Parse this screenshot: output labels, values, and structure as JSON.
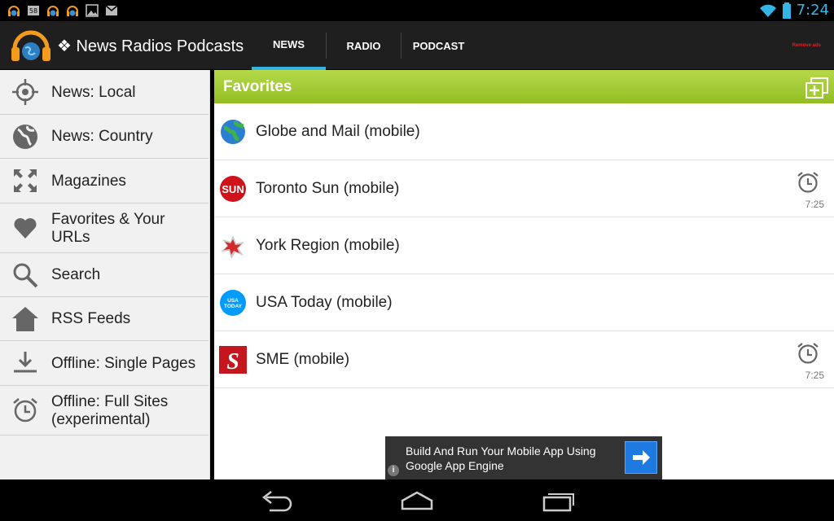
{
  "status_bar": {
    "time": "7:24",
    "left_icons": [
      "headphones-globe-icon",
      "sd-card-icon",
      "headphones-globe-icon",
      "headphones-globe-icon",
      "image-icon",
      "gmail-icon"
    ],
    "right_icons": [
      "wifi-icon",
      "battery-icon"
    ]
  },
  "app": {
    "title": "❖ News Radios Podcasts",
    "tabs": [
      {
        "label": "NEWS",
        "active": true
      },
      {
        "label": "RADIO",
        "active": false
      },
      {
        "label": "PODCAST",
        "active": false
      }
    ],
    "remove_ads": "Remove ads"
  },
  "sidebar": {
    "items": [
      {
        "label": "News: Local",
        "icon": "location-target-icon"
      },
      {
        "label": "News: Country",
        "icon": "globe-icon"
      },
      {
        "label": "Magazines",
        "icon": "expand-arrows-icon"
      },
      {
        "label": "Favorites & Your URLs",
        "icon": "heart-icon"
      },
      {
        "label": "Search",
        "icon": "search-icon"
      },
      {
        "label": "RSS Feeds",
        "icon": "home-icon"
      },
      {
        "label": "Offline: Single Pages",
        "icon": "download-icon"
      },
      {
        "label": "Offline: Full Sites (experimental)",
        "icon": "alarm-clock-icon"
      }
    ]
  },
  "favorites": {
    "title": "Favorites",
    "rows": [
      {
        "name": "Globe and Mail (mobile)",
        "logo": "globe-logo-icon",
        "alarm": false,
        "time": ""
      },
      {
        "name": "Toronto Sun (mobile)",
        "logo": "sun-logo-icon",
        "alarm": true,
        "time": "7:25"
      },
      {
        "name": "York Region (mobile)",
        "logo": "york-region-logo-icon",
        "alarm": false,
        "time": ""
      },
      {
        "name": "USA Today (mobile)",
        "logo": "usa-today-logo-icon",
        "alarm": false,
        "time": ""
      },
      {
        "name": "SME (mobile)",
        "logo": "sme-logo-icon",
        "alarm": true,
        "time": "7:25"
      }
    ]
  },
  "ad": {
    "text": "Build And Run Your Mobile App Using Google App Engine",
    "info": "i"
  },
  "colors": {
    "accent": "#33b5e5",
    "favorites_header": "#a4cc34",
    "ad_button": "#1e7ae0"
  }
}
